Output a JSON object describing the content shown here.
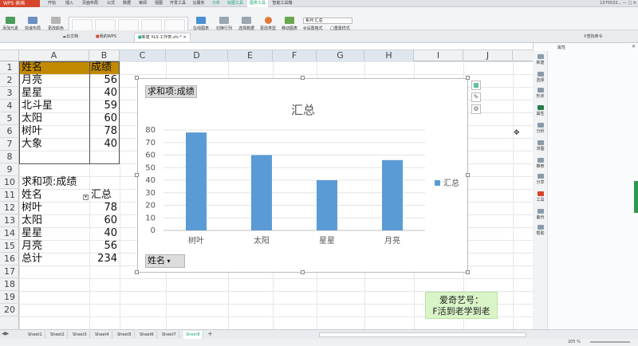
{
  "app": {
    "brand": "WPS 表格",
    "user": "1370532...",
    "menu_tabs": [
      "开始",
      "插入",
      "页面布局",
      "公式",
      "数据",
      "审阅",
      "视图",
      "开发工具",
      "云服务",
      "分析",
      "绘图工具",
      "图表工具",
      "智能工具箱"
    ]
  },
  "ribbon": {
    "buttons": [
      "添加元素",
      "快速布局",
      "更改颜色",
      "在线图表",
      "切换行列",
      "选择数据",
      "更改类型",
      "移动图表",
      "设置格式",
      "重置样式"
    ],
    "series_select": "系列 汇总"
  },
  "doc_tabs": [
    "云文档",
    "我的WPS",
    "新建 XLS 工作表.xls *"
  ],
  "search_label": "查找命令",
  "columns": [
    "A",
    "B",
    "C",
    "D",
    "E",
    "F",
    "G",
    "H",
    "I",
    "J"
  ],
  "rows": [
    "1",
    "2",
    "3",
    "4",
    "5",
    "6",
    "7",
    "8",
    "9",
    "10",
    "11",
    "12",
    "13",
    "14",
    "15",
    "16",
    "17",
    "18",
    "19",
    "20"
  ],
  "table1": {
    "header": [
      "姓名",
      "成绩"
    ],
    "rows": [
      [
        "月亮",
        "56"
      ],
      [
        "星星",
        "40"
      ],
      [
        "北斗星",
        "59"
      ],
      [
        "太阳",
        "60"
      ],
      [
        "树叶",
        "78"
      ],
      [
        "大象",
        "40"
      ]
    ]
  },
  "pivot": {
    "title": "求和项:成绩",
    "header": [
      "姓名",
      "汇总"
    ],
    "rows": [
      [
        "树叶",
        "78"
      ],
      [
        "太阳",
        "60"
      ],
      [
        "星星",
        "40"
      ],
      [
        "月亮",
        "56"
      ]
    ],
    "total": [
      "总计",
      "234"
    ]
  },
  "chart_field_buttons": {
    "value": "求和项:成绩",
    "axis": "姓名"
  },
  "chart_data": {
    "type": "bar",
    "title": "汇总",
    "categories": [
      "树叶",
      "太阳",
      "星星",
      "月亮"
    ],
    "series": [
      {
        "name": "汇总",
        "values": [
          78,
          60,
          40,
          56
        ]
      }
    ],
    "ylim": [
      0,
      80
    ],
    "yticks": [
      0,
      10,
      20,
      30,
      40,
      50,
      60,
      70,
      80
    ],
    "grid": true,
    "legend": "right",
    "bar_color": "#5b9bd5"
  },
  "sheets": [
    "Sheet1",
    "Sheet2",
    "Sheet3",
    "Sheet4",
    "Sheet5",
    "Sheet6",
    "Sheet7",
    "Sheet8"
  ],
  "right_tools": [
    "新建",
    "选择",
    "形状",
    "属性",
    "分析",
    "求图",
    "推荐",
    "分享",
    "工具",
    "备份",
    "帮助"
  ],
  "right_panel_title": "属性",
  "zoom": "205 %",
  "watermark": {
    "line1": "爱奇艺号：",
    "line2": "F活到老学到老"
  },
  "colors": {
    "accent": "#2a7a4a",
    "header_fill": "#c28a00",
    "brand": "#d5452b"
  }
}
